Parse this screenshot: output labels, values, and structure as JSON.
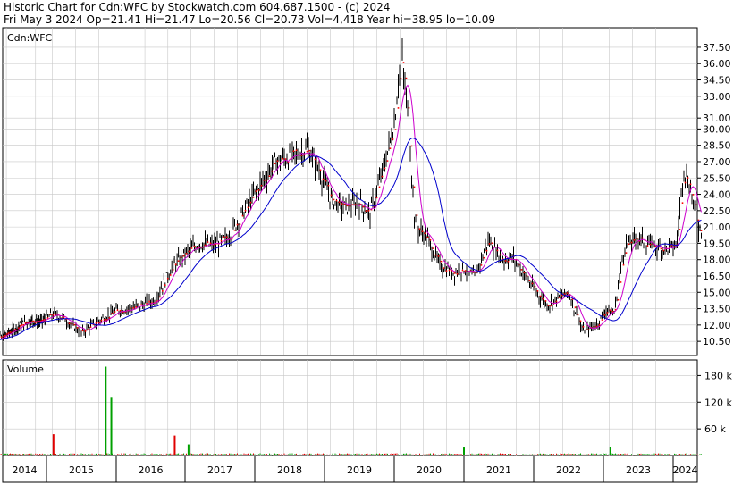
{
  "header": {
    "line1": "Historic Chart for Cdn:WFC by Stockwatch.com 604.687.1500 - (c) 2024",
    "line2": "Fri May  3 2024   Op=21.41  Hi=21.47  Lo=20.56  Cl=20.73  Vol=4,418  Year hi=38.95  lo=10.09"
  },
  "price_panel": {
    "symbol_label": "Cdn:WFC"
  },
  "volume_panel": {
    "label": "Volume"
  },
  "colors": {
    "price_bars": "#000000",
    "short_ma": "#ff0000",
    "mid_ma": "#cc00cc",
    "long_ma": "#0000cc",
    "volume_up": "#00a000",
    "volume_down": "#e00000",
    "grid": "#c8c8c8"
  },
  "chart_data": [
    {
      "type": "line",
      "name": "price",
      "x_ticks": [
        "2014",
        "2015",
        "2016",
        "2017",
        "2018",
        "2019",
        "2020",
        "2021",
        "2022",
        "2023",
        "2024"
      ],
      "y_ticks": [
        "10.50",
        "12.00",
        "13.50",
        "15.00",
        "16.50",
        "18.00",
        "19.50",
        "21.00",
        "22.50",
        "24.00",
        "25.50",
        "27.00",
        "28.50",
        "30.00",
        "31.00",
        "33.00",
        "34.50",
        "36.00",
        "37.50"
      ],
      "ylim": [
        9.2,
        39.3
      ],
      "grid": true,
      "close_anchors": [
        [
          2013.75,
          10.6
        ],
        [
          2014.0,
          10.9
        ],
        [
          2014.3,
          11.7
        ],
        [
          2014.6,
          12.4
        ],
        [
          2014.9,
          12.3
        ],
        [
          2015.1,
          13.0
        ],
        [
          2015.25,
          12.6
        ],
        [
          2015.5,
          11.3
        ],
        [
          2015.75,
          12.4
        ],
        [
          2016.0,
          13.3
        ],
        [
          2016.3,
          13.7
        ],
        [
          2016.55,
          14.2
        ],
        [
          2016.8,
          17.2
        ],
        [
          2016.95,
          18.3
        ],
        [
          2017.2,
          19.5
        ],
        [
          2017.4,
          19.3
        ],
        [
          2017.6,
          19.9
        ],
        [
          2017.85,
          22.5
        ],
        [
          2018.05,
          24.6
        ],
        [
          2018.3,
          27.0
        ],
        [
          2018.55,
          27.5
        ],
        [
          2018.75,
          28.2
        ],
        [
          2018.9,
          26.5
        ],
        [
          2019.1,
          23.5
        ],
        [
          2019.3,
          22.8
        ],
        [
          2019.5,
          23.2
        ],
        [
          2019.65,
          22.2
        ],
        [
          2019.85,
          26.5
        ],
        [
          2020.0,
          30.5
        ],
        [
          2020.1,
          37.0
        ],
        [
          2020.2,
          31.0
        ],
        [
          2020.3,
          21.0
        ],
        [
          2020.45,
          20.2
        ],
        [
          2020.65,
          17.5
        ],
        [
          2020.85,
          16.8
        ],
        [
          2021.0,
          17.2
        ],
        [
          2021.15,
          16.3
        ],
        [
          2021.35,
          19.8
        ],
        [
          2021.55,
          18.0
        ],
        [
          2021.7,
          18.2
        ],
        [
          2021.9,
          16.2
        ],
        [
          2022.05,
          14.9
        ],
        [
          2022.2,
          13.8
        ],
        [
          2022.35,
          14.5
        ],
        [
          2022.5,
          15.0
        ],
        [
          2022.7,
          11.4
        ],
        [
          2022.9,
          12.0
        ],
        [
          2023.05,
          13.5
        ],
        [
          2023.15,
          13.0
        ],
        [
          2023.3,
          19.2
        ],
        [
          2023.5,
          20.0
        ],
        [
          2023.7,
          19.2
        ],
        [
          2023.9,
          19.0
        ],
        [
          2024.05,
          19.3
        ],
        [
          2024.15,
          26.5
        ],
        [
          2024.25,
          24.5
        ],
        [
          2024.35,
          21.0
        ],
        [
          2024.42,
          20.73
        ]
      ],
      "series": [
        {
          "role": "short_ma",
          "periods_weeks": 4
        },
        {
          "role": "mid_ma",
          "periods_weeks": 10
        },
        {
          "role": "long_ma",
          "periods_weeks": 30
        }
      ]
    },
    {
      "type": "bar",
      "name": "volume",
      "y_ticks": [
        "60 k",
        "120 k",
        "180 k"
      ],
      "ylim": [
        0,
        215
      ],
      "baseline_range_k": [
        1.5,
        5
      ],
      "spikes": [
        {
          "x": 2015.1,
          "value": 48,
          "dir": "down"
        },
        {
          "x": 2015.85,
          "value": 200,
          "dir": "up"
        },
        {
          "x": 2015.93,
          "value": 130,
          "dir": "up"
        },
        {
          "x": 2016.85,
          "value": 45,
          "dir": "down"
        },
        {
          "x": 2017.05,
          "value": 25,
          "dir": "up"
        },
        {
          "x": 2021.0,
          "value": 18,
          "dir": "up"
        },
        {
          "x": 2023.1,
          "value": 20,
          "dir": "up"
        }
      ]
    }
  ]
}
